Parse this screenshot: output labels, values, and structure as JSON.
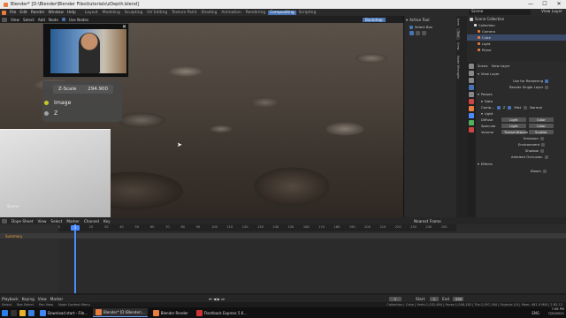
{
  "window": {
    "title": "Blender* [D:\\Blender\\Blender Files\\tutorials\\zDepth.blend]",
    "min": "—",
    "max": "☐",
    "close": "✕"
  },
  "menu": {
    "items": [
      "File",
      "Edit",
      "Render",
      "Window",
      "Help"
    ],
    "workspaces": [
      "Layout",
      "Modeling",
      "Sculpting",
      "UV Editing",
      "Texture Paint",
      "Shading",
      "Animation",
      "Rendering",
      "Compositing",
      "Scripting"
    ],
    "active_workspace": "Compositing",
    "scene": "Scene",
    "view_layer": "View Layer"
  },
  "viewport": {
    "menu": [
      "View",
      "Select",
      "Add",
      "Node"
    ],
    "use_nodes": "Use Nodes",
    "backdrop": "Backdrop",
    "label": "Scene"
  },
  "node": {
    "zscale_label": "Z-Scale",
    "zscale_value": "294.900",
    "sockets": [
      "Image",
      "Z"
    ],
    "socket_colors": [
      "#c7c729",
      "#a1a1a1"
    ]
  },
  "ntool": {
    "header": "Active Tool",
    "select_box": "Select Box"
  },
  "tabs": [
    "Item",
    "Tool",
    "View",
    "Node Wrangler"
  ],
  "outliner": {
    "header": "Scene Collection",
    "items": [
      "Collection",
      "Camera",
      "Cube",
      "Light",
      "Plane"
    ]
  },
  "props": {
    "scene": "Scene",
    "view_layer": "View Layer",
    "section_view_layer": "View Layer",
    "use_for_rendering": "Use for Rendering",
    "render_single_layer": "Render Single Layer",
    "passes": "Passes",
    "data": "Data",
    "combined": "Comb...",
    "z": "Z",
    "mist": "Mist",
    "normal": "Normal",
    "light": "Light",
    "diffuse": "Diffuse",
    "specular": "Specular",
    "volume": "Volume",
    "light_btn": "Light",
    "color_btn": "Color",
    "transmittance": "Transmittance",
    "scatter": "Scatter",
    "emission": "Emission",
    "environment": "Environment",
    "shadow": "Shadow",
    "ambient_occlusion": "Ambient Occlusion",
    "effects": "Effects",
    "bloom": "Bloom"
  },
  "timeline": {
    "mode": "Dope Sheet",
    "menu": [
      "View",
      "Select",
      "Marker",
      "Channel",
      "Key"
    ],
    "summary": "Summary",
    "frames": [
      "0",
      "10",
      "20",
      "30",
      "40",
      "50",
      "60",
      "70",
      "80",
      "90",
      "100",
      "110",
      "120",
      "130",
      "140",
      "150",
      "160",
      "170",
      "180",
      "190",
      "200",
      "210",
      "220",
      "230",
      "240",
      "250"
    ],
    "current_frame": "1",
    "nearest_frame": "Nearest Frame"
  },
  "playback": {
    "menu": [
      "Playback",
      "Keying",
      "View",
      "Marker"
    ],
    "start_label": "Start",
    "start": "1",
    "end_label": "End",
    "end": "250",
    "frame": "1"
  },
  "status": {
    "left": [
      "Select",
      "Box Select",
      "Pan View",
      "Node Context Menu"
    ],
    "right": "Collection | Cube | Verts:1,032,484 | Faces:1,048,182 | Tris:2,097,164 | Objects:1/4 | Mem: 481.9 MiB | 2.83.12"
  },
  "taskbar": {
    "items": [
      "Download start - File...",
      "Blender* [D:\\Blender\\...",
      "Blender Render",
      "Flashback Express 5.6..."
    ],
    "time": "7:08 PM",
    "date": "7/20/2021",
    "lang": "ENG"
  },
  "colors": {
    "accent": "#4772b3",
    "playhead": "#4a8bff",
    "icon_orange": "#e87d3e",
    "icon_green": "#52b25c"
  }
}
